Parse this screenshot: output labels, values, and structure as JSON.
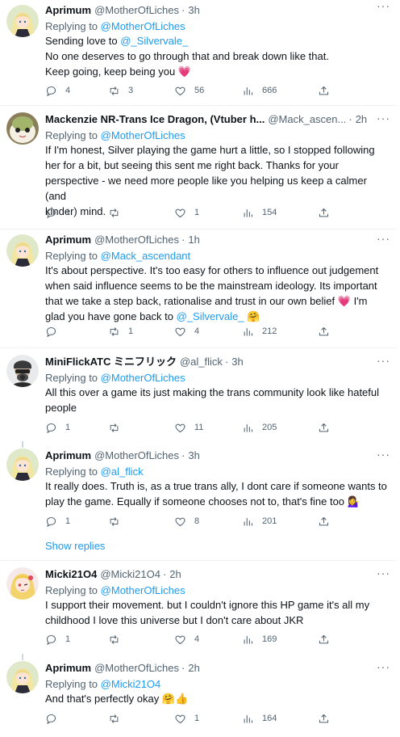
{
  "reply_prefix": "Replying to",
  "show_replies": "Show replies",
  "more_label": "···",
  "tweets": [
    {
      "name": "Aprimum",
      "handle": "@MotherOfLiches",
      "time": "3h",
      "replying_to": "@MotherOfLiches",
      "lines": [
        [
          {
            "t": "Sending love to "
          },
          {
            "t": "@_Silvervale_",
            "link": true
          }
        ],
        [
          {
            "t": "No one deserves to go through that and break down like that."
          }
        ],
        [
          {
            "t": "Keep going, keep being you "
          },
          {
            "t": "💗",
            "heart": true
          }
        ]
      ],
      "replies": "4",
      "retweets": "3",
      "likes": "56",
      "views": "666"
    },
    {
      "name": "Mackenzie NR-Trans Ice Dragon, (Vtuber h...",
      "handle": "@Mack_ascen...",
      "time": "2h",
      "replying_to": "@MotherOfLiches",
      "lines": [
        [
          {
            "t": "If I'm honest, Silver playing the game hurt a little, so I stopped following"
          }
        ],
        [
          {
            "t": "her for a bit, but seeing this sent me right back. Thanks for your"
          }
        ],
        [
          {
            "t": "perspective - we need more people like you helping us keep a calmer (and"
          }
        ],
        [
          {
            "t": "kinder) mind."
          }
        ]
      ],
      "replies": "1",
      "retweets": "",
      "likes": "1",
      "views": "154"
    },
    {
      "name": "Aprimum",
      "handle": "@MotherOfLiches",
      "time": "1h",
      "replying_to": "@Mack_ascendant",
      "lines": [
        [
          {
            "t": "It's about perspective.  It's too easy for others to influence out judgement"
          }
        ],
        [
          {
            "t": "when said influence seems to be the mainstream ideology. Its important"
          }
        ],
        [
          {
            "t": "that we take a step back, rationalise and trust in our own belief "
          },
          {
            "t": "💗",
            "heart": true
          },
          {
            "t": " I'm"
          }
        ],
        [
          {
            "t": "glad you have gone back to "
          },
          {
            "t": "@_Silvervale_",
            "link": true
          },
          {
            "t": " 🤗"
          }
        ]
      ],
      "replies": "",
      "retweets": "1",
      "likes": "4",
      "views": "212"
    },
    {
      "name": "MiniFlickATC ミニフリック",
      "handle": "@al_flick",
      "time": "3h",
      "replying_to": "@MotherOfLiches",
      "lines": [
        [
          {
            "t": "All this over a game its just making the trans community look like hateful"
          }
        ],
        [
          {
            "t": "people"
          }
        ]
      ],
      "replies": "1",
      "retweets": "",
      "likes": "11",
      "views": "205"
    },
    {
      "name": "Aprimum",
      "handle": "@MotherOfLiches",
      "time": "3h",
      "replying_to": "@al_flick",
      "lines": [
        [
          {
            "t": "It really does. Truth is, as a true trans ally, I dont care if someone wants to"
          }
        ],
        [
          {
            "t": "play the game. Equally if someone chooses not to, that's fine too 💁‍♀️"
          }
        ]
      ],
      "replies": "1",
      "retweets": "",
      "likes": "8",
      "views": "201"
    },
    {
      "name": "Micki21O4",
      "handle": "@Micki21O4",
      "time": "2h",
      "replying_to": "@MotherOfLiches",
      "lines": [
        [
          {
            "t": "I support their movement.  but I couldn't ignore this HP game it's all my"
          }
        ],
        [
          {
            "t": "childhood I love this universe but I don't care about JKR"
          }
        ]
      ],
      "replies": "1",
      "retweets": "",
      "likes": "4",
      "views": "169"
    },
    {
      "name": "Aprimum",
      "handle": "@MotherOfLiches",
      "time": "2h",
      "replying_to": "@Micki21O4",
      "lines": [
        [
          {
            "t": "And that's perfectly okay 🤗👍"
          }
        ]
      ],
      "replies": "",
      "retweets": "",
      "likes": "1",
      "views": "164"
    }
  ]
}
